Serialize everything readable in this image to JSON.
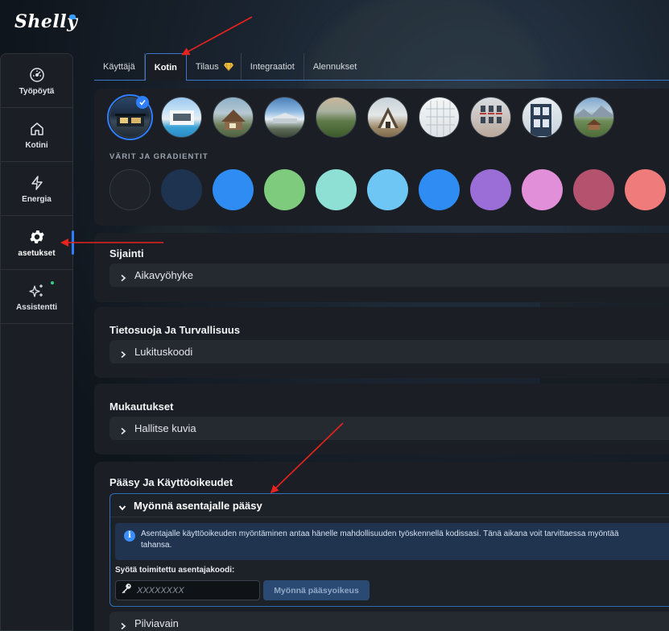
{
  "app": {
    "logo": "Shelly"
  },
  "sidebar": {
    "items": [
      {
        "label": "Työpöytä",
        "icon": "dashboard-icon"
      },
      {
        "label": "Kotini",
        "icon": "home-icon"
      },
      {
        "label": "Energia",
        "icon": "lightning-icon"
      },
      {
        "label": "asetukset",
        "icon": "gear-icon",
        "active": true
      },
      {
        "label": "Assistentti",
        "icon": "sparkle-icon"
      }
    ]
  },
  "tabs": [
    {
      "label": "Käyttäjä"
    },
    {
      "label": "Kotin",
      "active": true
    },
    {
      "label": "Tilaus",
      "icon": "diamond-icon"
    },
    {
      "label": "Integraatiot"
    },
    {
      "label": "Alennukset"
    }
  ],
  "gallery": {
    "images": [
      "modern-house-night",
      "villa-pool",
      "wooden-house",
      "house-rooftop",
      "landscape-hills",
      "a-frame-house",
      "white-building",
      "apartment-facade",
      "blue-building",
      "mountain-chalet"
    ],
    "selected_index": 0,
    "colors_title": "VÄRIT JA GRADIENTIT",
    "swatches": [
      "#1f2329",
      "#1e3350",
      "#2f8cf2",
      "#7ecb7e",
      "#8fe0d4",
      "#6ec6f5",
      "#2f8cf2",
      "#9b6dd6",
      "#e08fd8",
      "#b5526e",
      "#f07b7b"
    ]
  },
  "sections": {
    "location": {
      "title": "Sijainti",
      "row": "Aikavyöhyke"
    },
    "privacy": {
      "title": "Tietosuoja Ja Turvallisuus",
      "row": "Lukituskoodi"
    },
    "custom": {
      "title": "Mukautukset",
      "row": "Hallitse kuvia"
    },
    "access": {
      "title": "Pääsy Ja Käyttöoikeudet",
      "expanded_label": "Myönnä asentajalle pääsy",
      "info_line1": "Asentajalle käyttöoikeuden myöntäminen antaa hänelle mahdollisuuden työskennellä kodissasi. Tänä aikana voit tarvittaessa myöntää",
      "info_line2": "tahansa.",
      "code_label": "Syötä toimitettu asentajakoodi:",
      "code_placeholder": "XXXXXXXX",
      "grant_button": "Myönnä pääsyoikeus",
      "next_row": "Pilviavain"
    }
  },
  "colors": {
    "accent": "#2d7fff",
    "annotation_arrow": "#e8231d"
  }
}
